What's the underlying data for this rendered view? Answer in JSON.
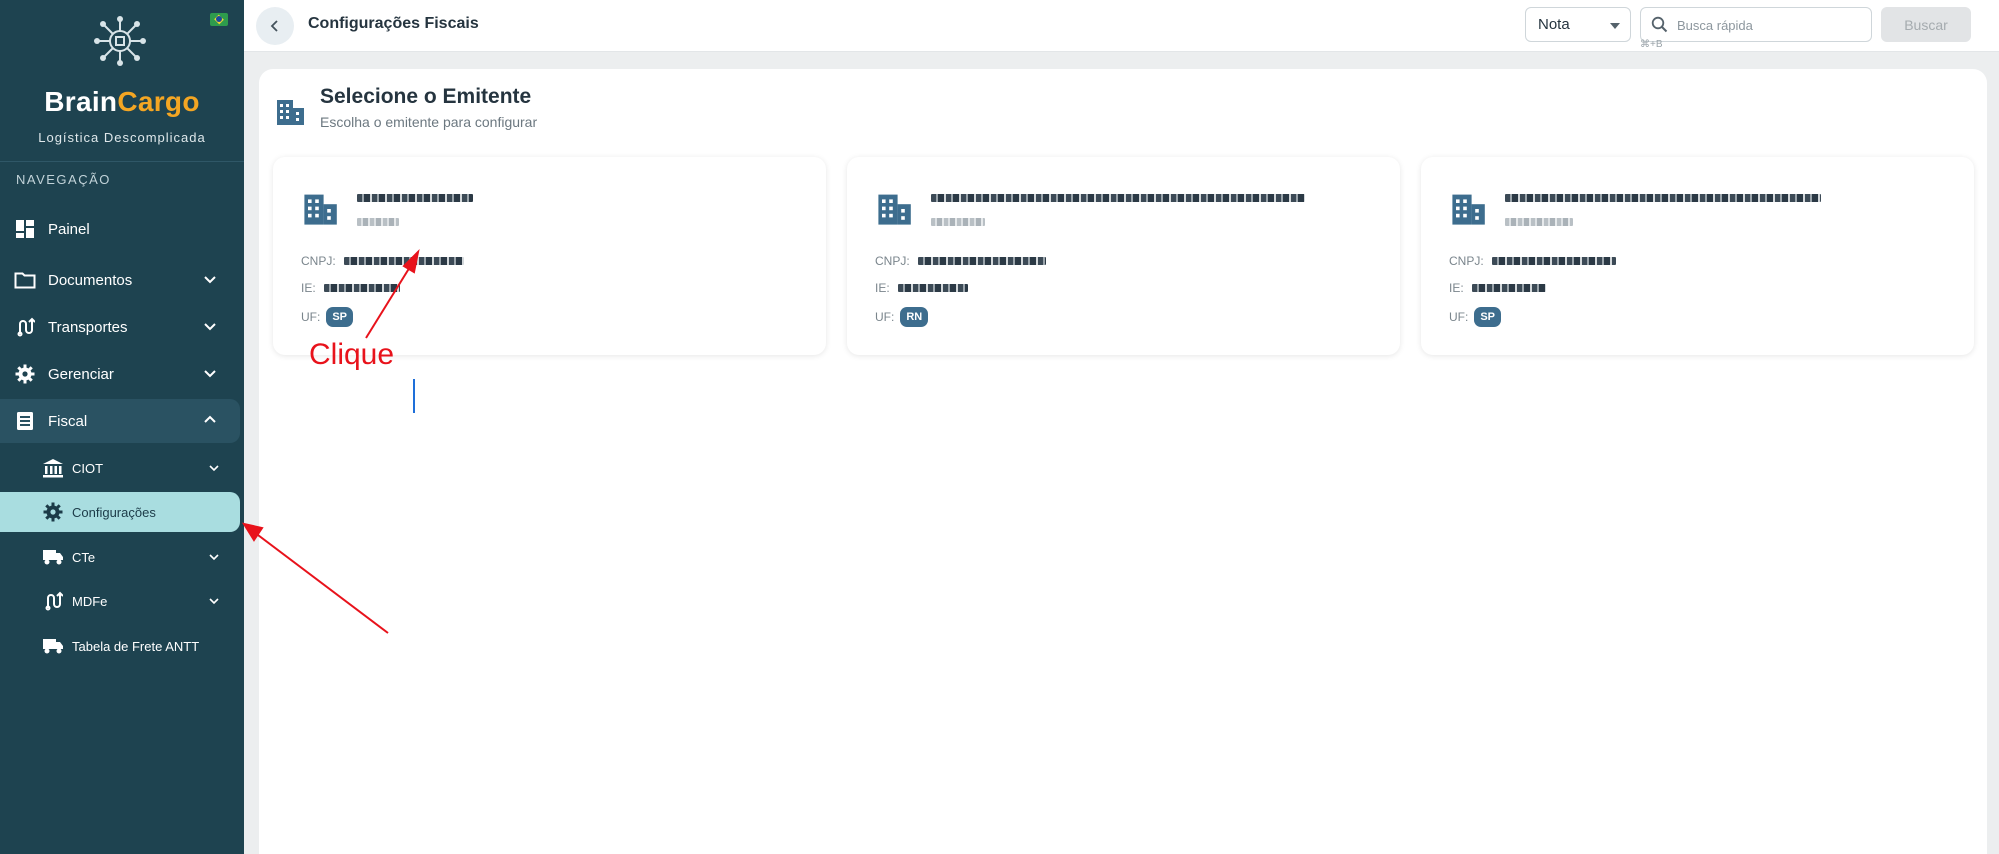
{
  "sidebar": {
    "brand_part1": "Brain",
    "brand_part2": "Cargo",
    "tagline": "Logística Descomplicada",
    "flag_icon": "brazil-flag-icon",
    "nav_heading": "NAVEGAÇÃO",
    "items": [
      {
        "label": "Painel",
        "icon": "dashboard-icon"
      },
      {
        "label": "Documentos",
        "icon": "folder-icon",
        "chevron": "down"
      },
      {
        "label": "Transportes",
        "icon": "route-icon",
        "chevron": "down"
      },
      {
        "label": "Gerenciar",
        "icon": "gear-icon",
        "chevron": "down"
      },
      {
        "label": "Fiscal",
        "icon": "list-icon",
        "chevron": "up"
      }
    ],
    "fiscal_sub": [
      {
        "label": "CIOT",
        "icon": "bank-icon",
        "chevron": "down"
      },
      {
        "label": "Configurações",
        "icon": "gear-icon",
        "active": true
      },
      {
        "label": "CTe",
        "icon": "truck-icon",
        "chevron": "down"
      },
      {
        "label": "MDFe",
        "icon": "route-icon",
        "chevron": "down"
      },
      {
        "label": "Tabela de Frete ANTT",
        "icon": "truck-icon"
      }
    ]
  },
  "topbar": {
    "title": "Configurações Fiscais",
    "doc_type_select": "Nota",
    "search_placeholder": "Busca rápida",
    "search_shortcut": "⌘+B",
    "search_button": "Buscar"
  },
  "panel": {
    "title": "Selecione o Emitente",
    "subtitle": "Escolha o emitente para configurar",
    "labels": {
      "cnpj": "CNPJ:",
      "ie": "IE:",
      "uf": "UF:"
    },
    "emitentes": [
      {
        "uf": "SP"
      },
      {
        "uf": "RN"
      },
      {
        "uf": "SP"
      }
    ]
  },
  "annotation": {
    "text": "Clique",
    "color": "#e8121b"
  },
  "colors": {
    "sidebar_bg": "#1e4350",
    "brand_accent": "#f4a623",
    "active_item_bg": "#a9dde0",
    "badge_bg": "#3d6d8e"
  }
}
